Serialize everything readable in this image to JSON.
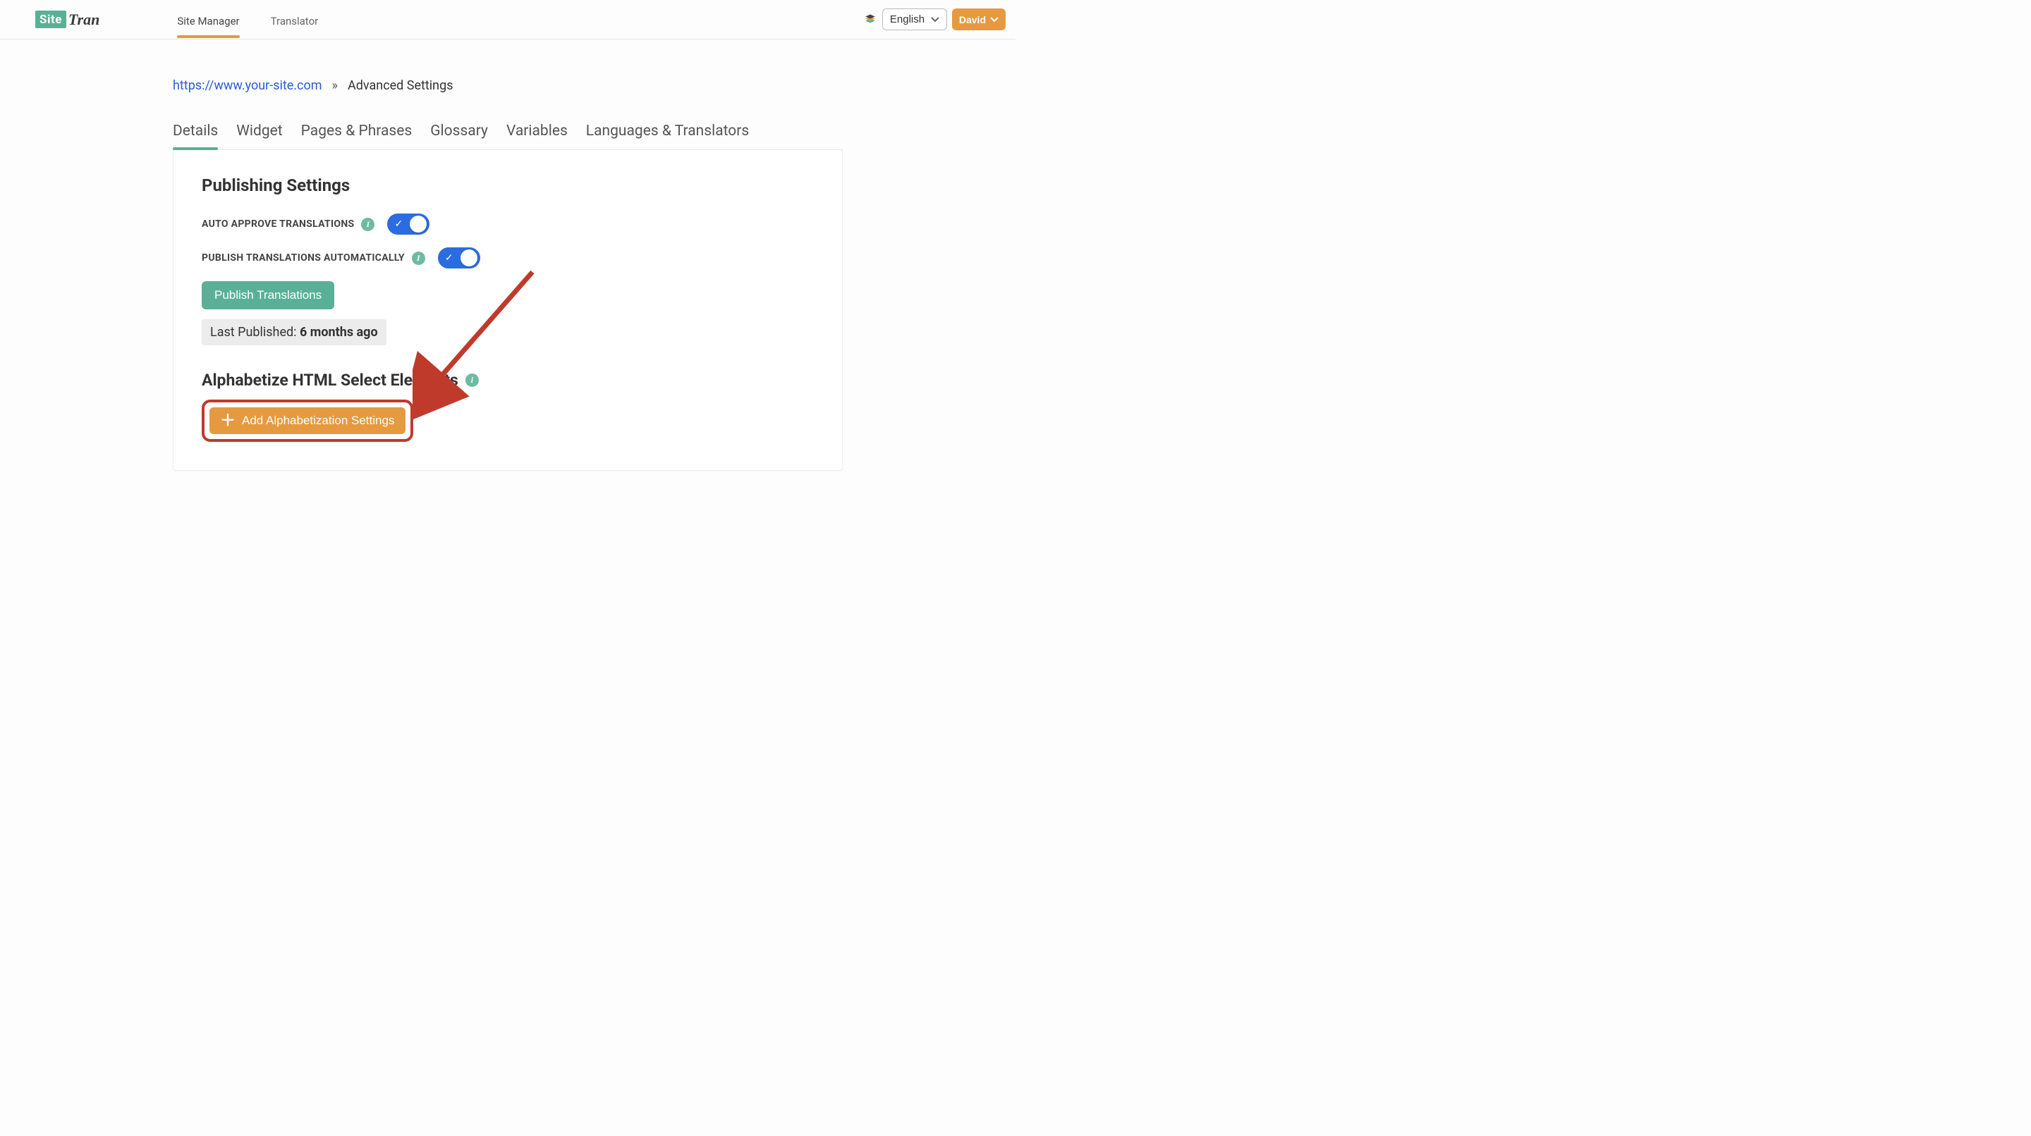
{
  "logo": {
    "box": "Site",
    "script": "Tran"
  },
  "topnav": {
    "site_manager": "Site Manager",
    "translator": "Translator"
  },
  "lang": {
    "selected": "English"
  },
  "user": {
    "name": "David"
  },
  "breadcrumb": {
    "site_url": "https://www.your-site.com",
    "sep": "»",
    "current": "Advanced Settings"
  },
  "tabs": {
    "details": "Details",
    "widget": "Widget",
    "pages_phrases": "Pages & Phrases",
    "glossary": "Glossary",
    "variables": "Variables",
    "languages_translators": "Languages & Translators"
  },
  "publishing": {
    "heading": "Publishing Settings",
    "auto_approve_label": "AUTO APPROVE TRANSLATIONS",
    "auto_approve_on": true,
    "publish_auto_label": "PUBLISH TRANSLATIONS AUTOMATICALLY",
    "publish_auto_on": true,
    "publish_btn": "Publish Translations",
    "last_published_prefix": "Last Published: ",
    "last_published_value": "6 months ago"
  },
  "alphabetize": {
    "heading": "Alphabetize HTML Select Elements",
    "add_btn": "Add Alphabetization Settings"
  }
}
